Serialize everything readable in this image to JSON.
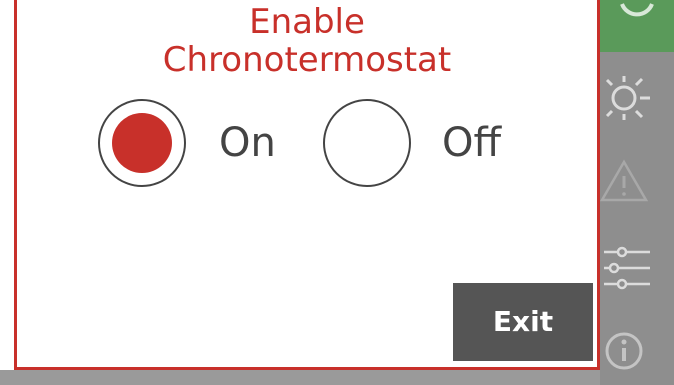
{
  "dialog": {
    "title_line1": "Enable",
    "title_line2": "Chronotermostat",
    "options": [
      {
        "label": "On",
        "selected": true
      },
      {
        "label": "Off",
        "selected": false
      }
    ],
    "exit_label": "Exit"
  },
  "sidebar": {
    "icons": [
      "power-icon",
      "sun-icon",
      "warning-icon",
      "sliders-icon",
      "info-icon"
    ]
  },
  "colors": {
    "accent": "#c8302a",
    "sidebar": "#8e8e8e",
    "sidebar_active": "#5a9a5a",
    "button": "#555555"
  }
}
